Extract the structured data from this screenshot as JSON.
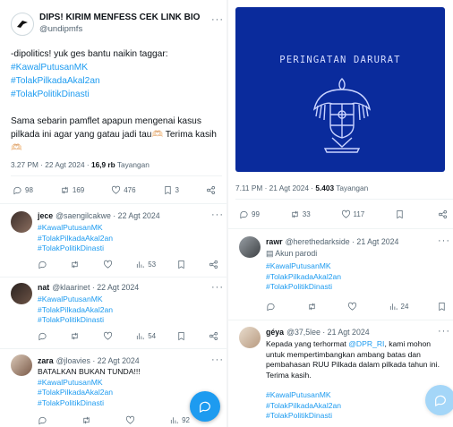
{
  "main_tweet": {
    "name": "DIPS! KIRIM MENFESS CEK LINK BIO",
    "handle": "@undipmfs",
    "intro": "-dipolitics! yuk ges bantu naikin taggar:",
    "hashtags": [
      "#KawalPutusanMK",
      "#TolakPilkadaAkal2an",
      "#TolakPolitikDinasti"
    ],
    "text": "Sama sebarin pamflet apapun mengenai kasus pilkada ini agar yang gatau jadi tau🫶🏻 Terima kasih 🫶🏻",
    "time": "3.27 PM · 22 Agt 2024",
    "views": "16,9 rb",
    "views_label": "Tayangan",
    "replies": "98",
    "retweets": "169",
    "likes": "476",
    "bookmarks": "3"
  },
  "left_replies": [
    {
      "name": "jece",
      "handle": "@saengilcakwe · 22 Agt 2024",
      "lines": [
        "#KawalPutusanMK",
        "#TolakPilkadaAkal2an",
        "#TolakPolitikDinasti"
      ],
      "views": "53"
    },
    {
      "name": "nat",
      "handle": "@klaarinet · 22 Agt 2024",
      "lines": [
        "#KawalPutusanMK",
        "#TolakPilkadaAkal2an",
        "#TolakPolitikDinasti"
      ],
      "views": "54"
    },
    {
      "name": "zara",
      "handle": "@jloavies · 22 Agt 2024",
      "plain": "BATALKAN BUKAN TUNDA!!!",
      "lines": [
        "#KawalPutusanMK",
        "#TolakPilkadaAkal2an",
        "#TolakPolitikDinasti"
      ],
      "views": "92"
    }
  ],
  "image_tweet": {
    "banner_text": "PERINGATAN DARURAT",
    "time": "7.11 PM · 21 Agt 2024",
    "views": "5.403",
    "views_label": "Tayangan",
    "replies": "99",
    "retweets": "33",
    "likes": "117"
  },
  "right_replies": [
    {
      "name": "rawr",
      "handle": "@herethedarkside · 21 Agt 2024",
      "sub": "Akun parodi",
      "lines": [
        "#KawalPutusanMK",
        "#TolakPilkadaAkal2an",
        "#TolakPolitikDinasti"
      ],
      "views": "24"
    },
    {
      "name": "géya",
      "handle": "@37,5lee · 21 Agt 2024",
      "text_pre": "Kepada yang terhormat ",
      "mention": "@DPR_RI",
      "text_post": ", kami mohon untuk mempertimbangkan ambang batas dan pembahasan RUU Pilkada dalam pilkada tahun ini. Terima kasih.",
      "lines": [
        "#KawalPutusanMK",
        "#TolakPilkadaAkal2an",
        "#TolakPolitikDinasti"
      ]
    }
  ],
  "more_glyph": "···",
  "colors": {
    "link": "#1d9bf0",
    "muted": "#536471",
    "banner": "#0a2b9c"
  }
}
